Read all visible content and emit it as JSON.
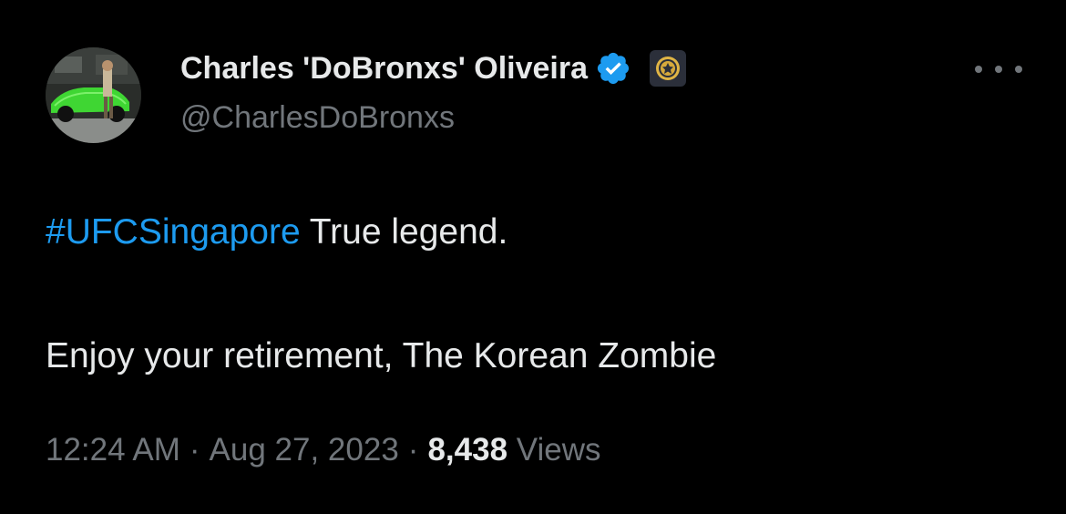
{
  "author": {
    "display_name": "Charles 'DoBronxs' Oliveira",
    "handle": "@CharlesDoBronxs",
    "avatar_icon": "profile-photo-car",
    "verified_icon": "verified-badge-icon",
    "affiliate_icon": "affiliate-badge-icon"
  },
  "tweet": {
    "hashtag": "#UFCSingapore",
    "line1_rest": " True legend.",
    "line2": "Enjoy your retirement, The Korean Zombie"
  },
  "meta": {
    "time": "12:24 AM",
    "separator": "·",
    "date": "Aug 27, 2023",
    "views_count": "8,438",
    "views_label": "Views"
  },
  "colors": {
    "background": "#000000",
    "primary_text": "#e7e9ea",
    "secondary_text": "#71767b",
    "link": "#1d9bf0",
    "verified": "#1d9bf0"
  }
}
